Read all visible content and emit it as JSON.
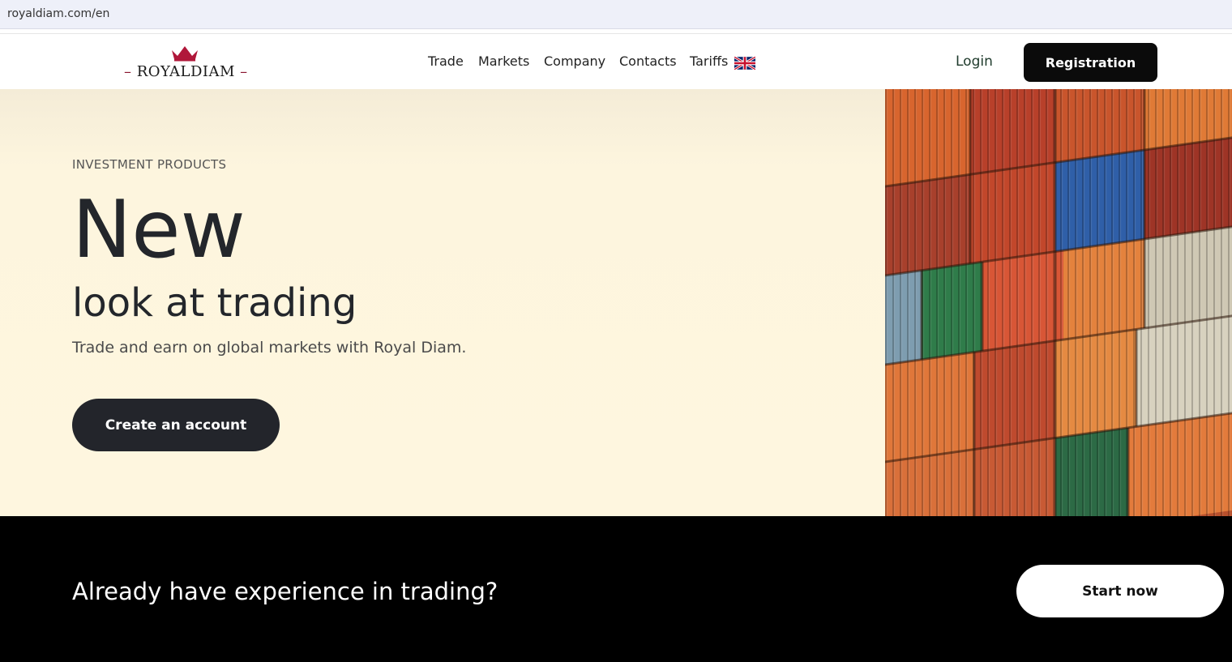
{
  "browser": {
    "url": "royaldiam.com/en"
  },
  "header": {
    "logo_text": "ROYALDIAM",
    "nav": [
      {
        "label": "Trade"
      },
      {
        "label": "Markets"
      },
      {
        "label": "Company"
      },
      {
        "label": "Contacts"
      },
      {
        "label": "Tariffs"
      }
    ],
    "language_flag": "uk-flag-icon",
    "login_label": "Login",
    "registration_label": "Registration"
  },
  "hero": {
    "eyebrow": "INVESTMENT PRODUCTS",
    "title_big": "New",
    "title_rest": "look at trading",
    "subtitle": "Trade and earn on global markets with Royal Diam.",
    "cta_label": "Create an account",
    "image": "shipping-containers-photo"
  },
  "band": {
    "text": "Already have experience in trading?",
    "button_label": "Start now"
  },
  "colors": {
    "hero_bg": "#fef6df",
    "dark_button": "#23252b",
    "brand_red": "#b0173a"
  }
}
